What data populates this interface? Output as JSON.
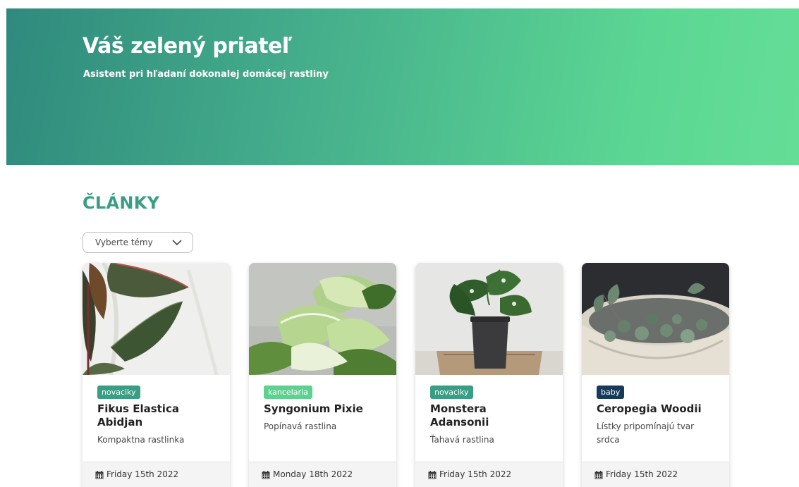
{
  "hero": {
    "title": "Váš zelený priateľ",
    "subtitle": "Asistent pri hľadaní dokonalej domácej rastliny"
  },
  "articles": {
    "section_title": "ČLÁNKY",
    "topic_select": {
      "selected_label": "Vyberte témy",
      "icon": "chevron-down-icon"
    },
    "cards": [
      {
        "tag": "novaciky",
        "tag_color": "#3a9e84",
        "title": "Fikus Elastica Abidjan",
        "description": "Kompaktna rastlinka",
        "date": "Friday 15th 2022",
        "image": "rubber-plant-image"
      },
      {
        "tag": "kancelaria",
        "tag_color": "#5fd08f",
        "title": "Syngonium Pixie",
        "description": "Popínavá rastlina",
        "date": "Monday 18th 2022",
        "image": "syngonium-image"
      },
      {
        "tag": "novaciky",
        "tag_color": "#3a9e84",
        "title": "Monstera Adansonii",
        "description": "Ťahavá rastlina",
        "date": "Friday 15th 2022",
        "image": "monstera-image"
      },
      {
        "tag": "baby",
        "tag_color": "#173a5a",
        "title": "Ceropegia Woodii",
        "description": "Lístky pripomínajú tvar srdca",
        "date": "Friday 15th 2022",
        "image": "ceropegia-image"
      }
    ]
  },
  "colors": {
    "accent": "#3a9e84",
    "hero_gradient_start": "#2f8a7d",
    "hero_gradient_end": "#64de97"
  }
}
